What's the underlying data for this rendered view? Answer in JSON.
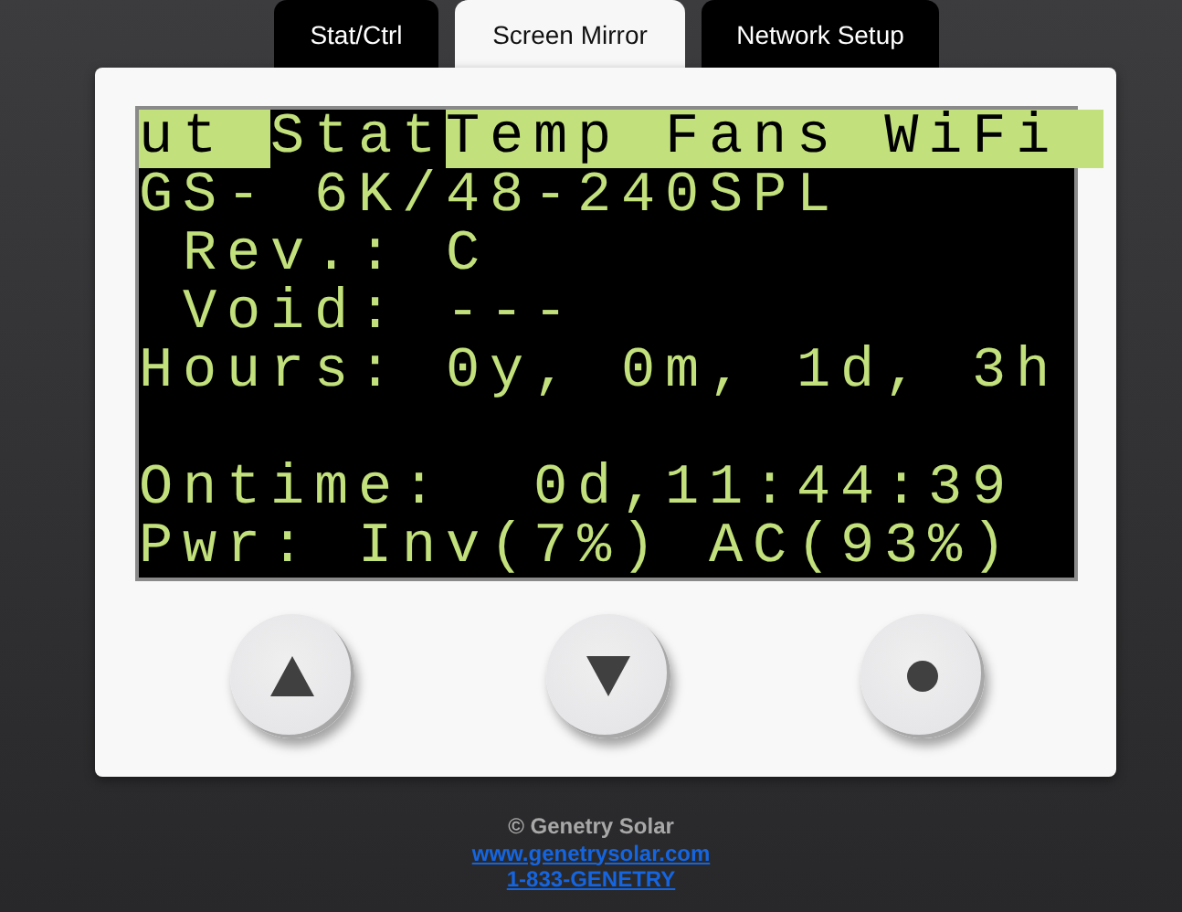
{
  "tabs": [
    {
      "label": "Stat/Ctrl",
      "selected": false
    },
    {
      "label": "Screen Mirror",
      "selected": true
    },
    {
      "label": "Network Setup",
      "selected": false
    }
  ],
  "lcd": {
    "menu": [
      {
        "label": "ut",
        "selected": false
      },
      {
        "label": "Stat",
        "selected": true
      },
      {
        "label": "Temp",
        "selected": false
      },
      {
        "label": "Fans",
        "selected": false
      },
      {
        "label": "WiFi",
        "selected": false
      }
    ],
    "info_lines": [
      "GS- 6K/48-240SPL",
      " Rev.: C",
      " Void: ---",
      "Hours: 0y, 0m, 1d, 3h"
    ],
    "status_lines": [
      "Ontime:  0d,11:44:39",
      "Pwr: Inv(7%) AC(93%)"
    ]
  },
  "buttons": [
    {
      "kind": "up"
    },
    {
      "kind": "down"
    },
    {
      "kind": "select"
    }
  ],
  "footer": {
    "copyright": "© Genetry Solar",
    "website": "www.genetrysolar.com",
    "phone": "1-833-GENETRY"
  }
}
